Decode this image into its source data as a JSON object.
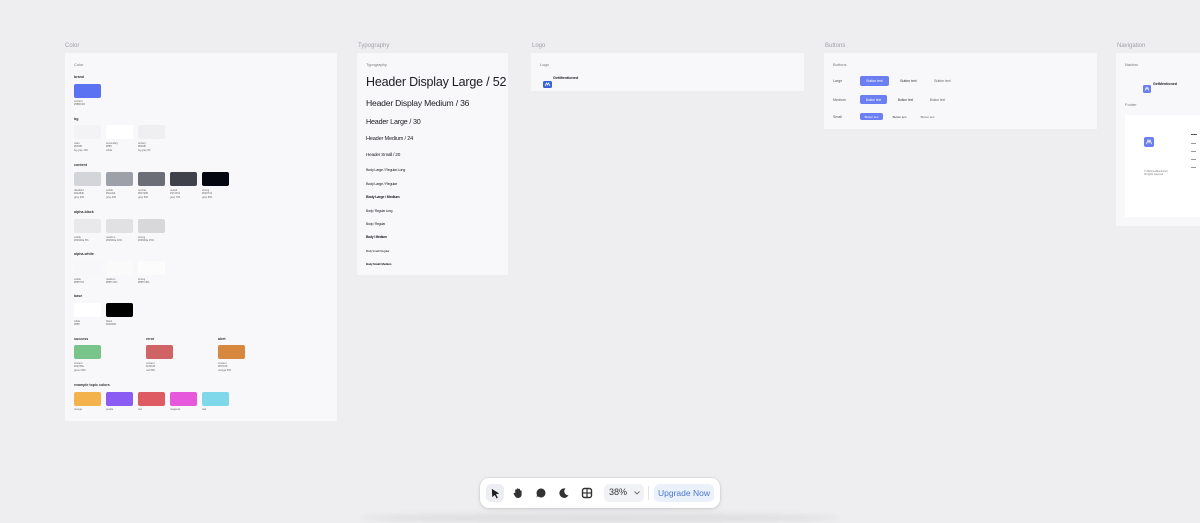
{
  "labels": {
    "color": "Color",
    "typography": "Typography",
    "logo": "Logo",
    "buttons": "Buttons",
    "navigation": "Navigation"
  },
  "color": {
    "title": "Color",
    "brand": {
      "title": "brand",
      "items": [
        {
          "name": "content",
          "hex": "#5B6CF0",
          "color": "#5b73f3"
        }
      ]
    },
    "bg": {
      "title": "bg",
      "items": [
        {
          "name": "main",
          "value": "#f3f4f6",
          "ref": "bg gray 100",
          "color": "#f3f3f5"
        },
        {
          "name": "secondary",
          "value": "#ffffff",
          "ref": "white",
          "color": "#ffffff"
        },
        {
          "name": "tertiary",
          "value": "#f9fafb",
          "ref": "bg gray 50",
          "color": "#efeff1"
        }
      ]
    },
    "content": {
      "title": "content",
      "items": [
        {
          "name": "disabled",
          "value": "#d1d5db",
          "ref": "gray 300",
          "color": "#d4d5d9"
        },
        {
          "name": "subtle",
          "value": "#9ca3af",
          "ref": "gray 400",
          "color": "#9da0a8"
        },
        {
          "name": "normal",
          "value": "#6b7280",
          "ref": "gray 500",
          "color": "#6b6e77"
        },
        {
          "name": "muted",
          "value": "#374151",
          "ref": "gray 700",
          "color": "#3f424a"
        },
        {
          "name": "strong",
          "value": "#030712",
          "ref": "gray 950",
          "color": "#050710"
        }
      ]
    },
    "alpha_black": {
      "title": "alpha-black",
      "items": [
        {
          "name": "subtle",
          "value": "#00000a 5%",
          "color": "#e9e9eb"
        },
        {
          "name": "medium",
          "value": "#00000a 10%",
          "color": "#e1e1e3"
        },
        {
          "name": "strong",
          "value": "#00000a 15%",
          "color": "#d8d8da"
        }
      ]
    },
    "alpha_white": {
      "title": "alpha-white",
      "items": [
        {
          "name": "subtle",
          "value": "#ffffff 5%",
          "color": "#f7f7f9"
        },
        {
          "name": "medium",
          "value": "#ffffff 10%",
          "color": "#fafafb"
        },
        {
          "name": "strong",
          "value": "#ffffff 15%",
          "color": "#fcfcfd"
        }
      ]
    },
    "base": {
      "title": "base",
      "items": [
        {
          "name": "white",
          "value": "#ffffff",
          "color": "#ffffff"
        },
        {
          "name": "black",
          "value": "#000000",
          "color": "#000000"
        }
      ]
    },
    "status": [
      {
        "title": "success",
        "name": "content",
        "value": "#22c55e",
        "ref": "green 500",
        "color": "#79c48a"
      },
      {
        "title": "error",
        "name": "content",
        "value": "#ef4444",
        "ref": "red 500",
        "color": "#cf6366"
      },
      {
        "title": "alert",
        "name": "content",
        "value": "#f97316",
        "ref": "orange 500",
        "color": "#d8873f"
      }
    ],
    "topic": {
      "title": "example topic colors",
      "items": [
        {
          "name": "orange",
          "color": "#f4b24c"
        },
        {
          "name": "purple",
          "color": "#8a5cf3"
        },
        {
          "name": "red",
          "color": "#df5b64"
        },
        {
          "name": "magenta",
          "color": "#e659dd"
        },
        {
          "name": "teal",
          "color": "#7ed8ea"
        }
      ]
    }
  },
  "typography": {
    "title": "Typography",
    "items": [
      "Header Display Large / 52",
      "Header Display Medium / 36",
      "Header Large / 30",
      "Header Medium / 24",
      "Header Small / 20",
      "Body Large / Regular Long",
      "Body Large / Regular",
      "Body Large / Medium",
      "Body / Regular Long",
      "Body / Regular",
      "Body / Medium",
      "Body Small / Regular",
      "Body Small / Medium"
    ]
  },
  "logo": {
    "title": "Logo",
    "name": "GetMentioned"
  },
  "buttons": {
    "title": "Buttons",
    "rows": [
      "Large",
      "Medium",
      "Small"
    ],
    "label": "Button text"
  },
  "navigation": {
    "navbar": "Navbar",
    "brand": "GetMentioned",
    "footer": "Footer",
    "footer_line1": "© 2024 GetMentioned",
    "footer_line2": "All rights reserved"
  },
  "toolbar": {
    "zoom": "38%",
    "upgrade": "Upgrade Now",
    "tools": [
      "pointer-icon",
      "hand-icon",
      "comment-icon",
      "moon-icon",
      "frame-icon"
    ]
  }
}
